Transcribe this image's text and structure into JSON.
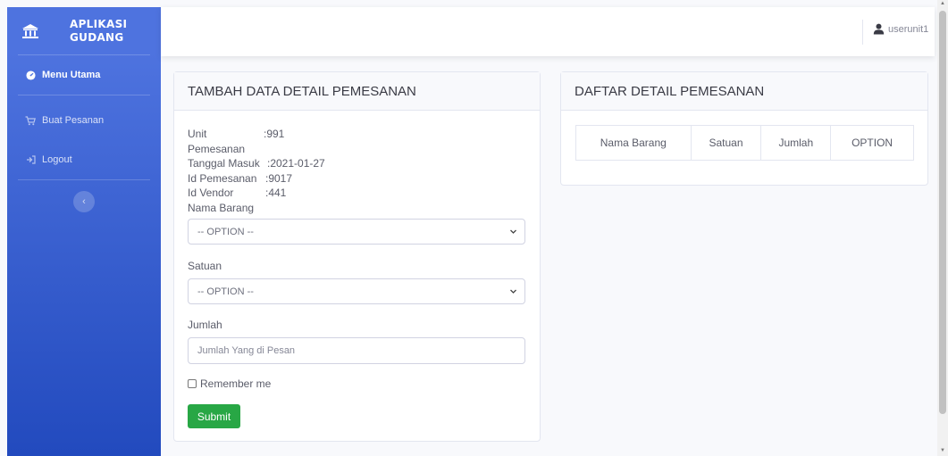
{
  "brand": {
    "line1": "APLIKASI",
    "line2": "GUDANG",
    "icon": "bank-icon"
  },
  "sidebar": {
    "items": [
      {
        "label": "Menu Utama",
        "icon": "dashboard-icon",
        "active": true
      },
      {
        "label": "Buat Pesanan",
        "icon": "cart-icon",
        "active": false
      },
      {
        "label": "Logout",
        "icon": "sign-out-icon",
        "active": false
      }
    ],
    "toggle_glyph": "‹"
  },
  "topbar": {
    "username": "userunit1",
    "icon": "user-icon"
  },
  "form": {
    "title": "TAMBAH DATA DETAIL PEMESANAN",
    "info": [
      {
        "key": "Unit Pemesanan",
        "value": ":991"
      },
      {
        "key": "Tanggal Masuk",
        "value": ":2021-01-27"
      },
      {
        "key": "Id Pemesanan",
        "value": ":9017"
      },
      {
        "key": "Id Vendor",
        "value": ":441"
      }
    ],
    "nama_barang": {
      "label": "Nama Barang",
      "selected": "-- OPTION --"
    },
    "satuan": {
      "label": "Satuan",
      "selected": "-- OPTION --"
    },
    "jumlah": {
      "label": "Jumlah",
      "placeholder": "Jumlah Yang di Pesan",
      "value": ""
    },
    "remember_label": "Remember me",
    "submit_label": "Submit"
  },
  "list": {
    "title": "DAFTAR DETAIL PEMESANAN",
    "columns": [
      "Nama Barang",
      "Satuan",
      "Jumlah",
      "OPTION"
    ]
  },
  "colors": {
    "sidebar_top": "#4e73df",
    "sidebar_bottom": "#224abe",
    "submit": "#28a745"
  }
}
